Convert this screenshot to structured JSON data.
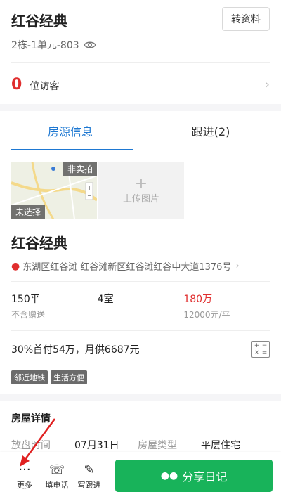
{
  "header": {
    "title": "红谷经典",
    "transfer_label": "转资料",
    "unit": "2栋-1单元-803",
    "visitor_count": "0",
    "visitor_label": "位访客"
  },
  "tabs": [
    {
      "label": "房源信息"
    },
    {
      "label": "跟进(2)"
    }
  ],
  "media": {
    "tag_real": "非实拍",
    "tag_unselected": "未选择",
    "upload_label": "上传图片"
  },
  "info": {
    "title": "红谷经典",
    "address": "东湖区红谷滩 红谷滩新区红谷滩红谷中大道1376号",
    "area": "150平",
    "area_sub": "不含赠送",
    "rooms": "4室",
    "price": "180万",
    "unit_price": "12000元/平",
    "payment": "30%首付54万，月供6687元",
    "badges": [
      "邻近地铁",
      "生活方便"
    ]
  },
  "details": {
    "title": "房屋详情",
    "row": [
      "放盘时间",
      "07月31日",
      "房屋类型",
      "平层住宅"
    ]
  },
  "bottom": {
    "more_label": "更多",
    "call_label": "填电话",
    "follow_label": "写跟进",
    "share_label": "分享日记"
  },
  "colors": {
    "accent_blue": "#1e78d2",
    "price_red": "#e02e2e",
    "share_green": "#18b35a"
  }
}
